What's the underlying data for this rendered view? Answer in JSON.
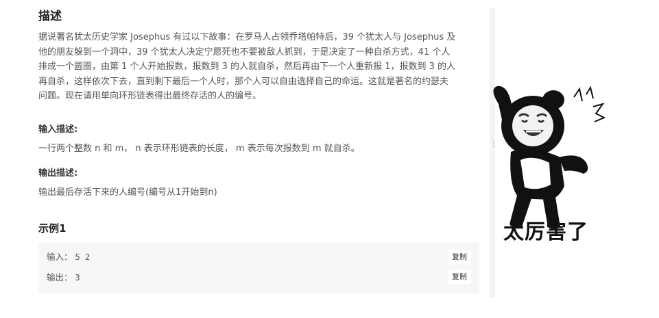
{
  "description": {
    "title": "描述",
    "lines": [
      "据说著名犹太历史学家 Josephus 有过以下故事：在罗马人占领乔塔帕特后，39 个犹太人与 Josephus 及",
      "他的朋友躲到一个洞中，39 个犹太人决定宁愿死也不要被敌人抓到，于是决定了一种自杀方式，41 个人",
      "排成一个圆圈，由第 1 个人开始报数，报数到 3 的人就自杀，然后再由下一个人重新报 1，报数到 3 的人",
      "再自杀，这样依次下去，直到剩下最后一个人时，那个人可以自由选择自己的命运。这就是著名的约瑟夫",
      "问题。现在请用单向环形链表得出最终存活的人的编号。"
    ]
  },
  "input_desc": {
    "label": "输入描述:",
    "text": "一行两个整数 n 和 m， n 表示环形链表的长度， m 表示每次报数到 m 就自杀。"
  },
  "output_desc": {
    "label": "输出描述:",
    "text": "输出最后存活下来的人编号(编号从1开始到n)"
  },
  "example": {
    "title": "示例1",
    "input_label": "输入：",
    "input_value": "5 2",
    "output_label": "输出：",
    "output_value": "3",
    "copy_label": "复制"
  },
  "sticker": {
    "caption": "太厉害了",
    "icon": "panda-meme-icon"
  },
  "colors": {
    "example_bg": "#f6f7f9",
    "text": "#555555",
    "heading": "#222222"
  }
}
